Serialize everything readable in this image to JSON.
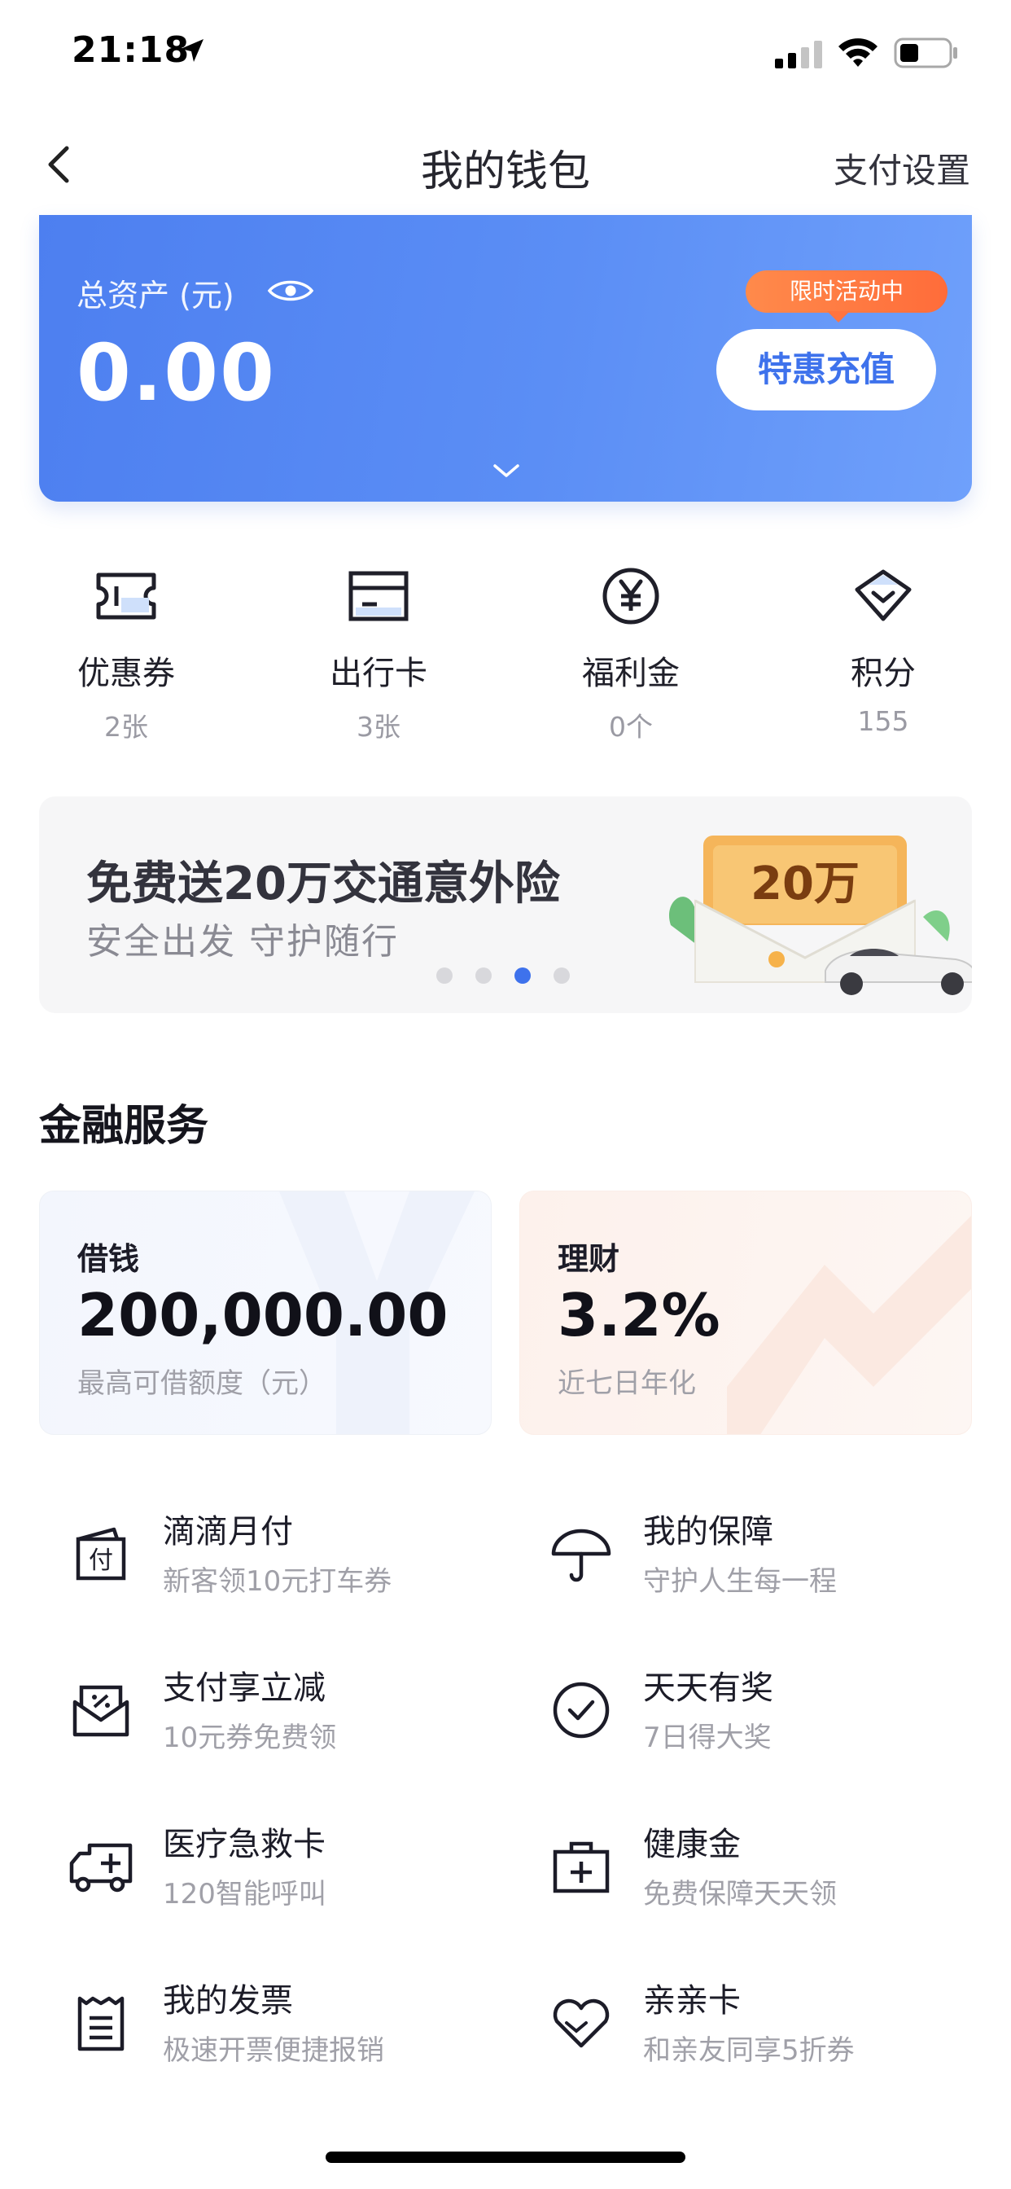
{
  "status_bar": {
    "time": "21:18"
  },
  "nav": {
    "title": "我的钱包",
    "right_action": "支付设置"
  },
  "asset_card": {
    "label": "总资产 (元)",
    "value": "0.00",
    "promo_tag": "限时活动中",
    "recharge_label": "特惠充值"
  },
  "quick_entries": [
    {
      "label": "优惠券",
      "count": "2张",
      "icon": "coupon-icon"
    },
    {
      "label": "出行卡",
      "count": "3张",
      "icon": "card-icon"
    },
    {
      "label": "福利金",
      "count": "0个",
      "icon": "yen-icon"
    },
    {
      "label": "积分",
      "count": "155",
      "icon": "diamond-icon"
    }
  ],
  "banner": {
    "title": "免费送20万交通意外险",
    "subtitle": "安全出发  守护随行",
    "art_text": "20万",
    "dots": 4,
    "active_dot": 2
  },
  "finance": {
    "section_title": "金融服务",
    "loan": {
      "name": "借钱",
      "value": "200,000.00",
      "desc": "最高可借额度（元）"
    },
    "invest": {
      "name": "理财",
      "value": "3.2%",
      "desc": "近七日年化"
    }
  },
  "services": [
    {
      "name": "滴滴月付",
      "desc": "新客领10元打车券",
      "icon": "monthly-pay-icon"
    },
    {
      "name": "我的保障",
      "desc": "守护人生每一程",
      "icon": "umbrella-icon"
    },
    {
      "name": "支付享立减",
      "desc": "10元券免费领",
      "icon": "discount-envelope-icon"
    },
    {
      "name": "天天有奖",
      "desc": "7日得大奖",
      "icon": "check-circle-icon"
    },
    {
      "name": "医疗急救卡",
      "desc": "120智能呼叫",
      "icon": "ambulance-icon"
    },
    {
      "name": "健康金",
      "desc": "免费保障天天领",
      "icon": "medical-kit-icon"
    },
    {
      "name": "我的发票",
      "desc": "极速开票便捷报销",
      "icon": "invoice-icon"
    },
    {
      "name": "亲亲卡",
      "desc": "和亲友同享5折券",
      "icon": "heart-icon"
    }
  ],
  "colors": {
    "accent": "#3e72ec",
    "promo": "#ff7440",
    "text": "#1c1c28",
    "muted": "#a0a0a8"
  }
}
